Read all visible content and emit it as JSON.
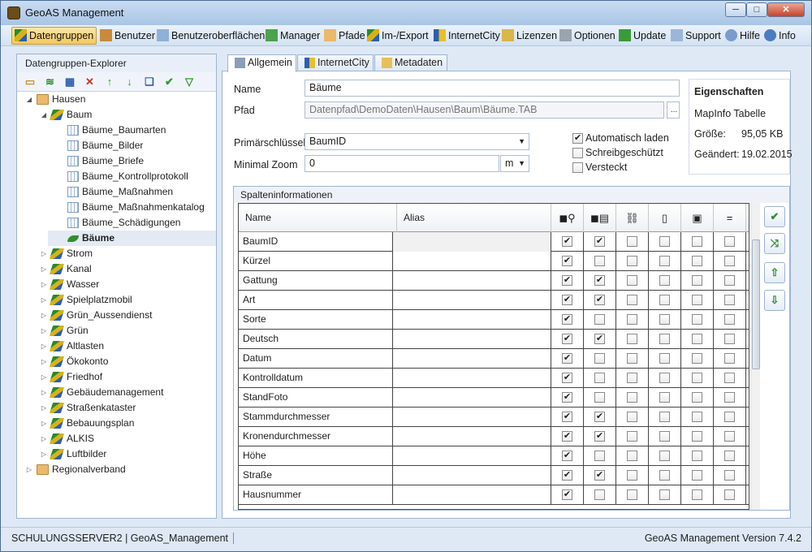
{
  "window": {
    "title": "GeoAS Management",
    "min_label": "─",
    "max_label": "□",
    "close_label": "✕"
  },
  "toolbar": [
    {
      "label": "Datengruppen",
      "icon": "layers-icon",
      "active": true
    },
    {
      "label": "Benutzer",
      "icon": "user-icon"
    },
    {
      "label": "Benutzeroberflächen",
      "icon": "window-icon"
    },
    {
      "label": "Manager",
      "icon": "puzzle-icon"
    },
    {
      "label": "Pfade",
      "icon": "folder-icon"
    },
    {
      "label": "Im-/Export",
      "icon": "layers-icon"
    },
    {
      "label": "InternetCity",
      "icon": "internetcity-icon"
    },
    {
      "label": "Lizenzen",
      "icon": "key-icon"
    },
    {
      "label": "Optionen",
      "icon": "gear-icon"
    },
    {
      "label": "Update",
      "icon": "refresh-icon"
    },
    {
      "label": "Support",
      "icon": "mail-icon"
    },
    {
      "label": "Hilfe",
      "icon": "help-icon"
    },
    {
      "label": "Info",
      "icon": "info-icon"
    }
  ],
  "explorer": {
    "title": "Datengruppen-Explorer",
    "tools": [
      "add-folder-icon",
      "add-layer-icon",
      "add-table-icon",
      "delete-icon",
      "move-up-icon",
      "move-down-icon",
      "book-icon",
      "check-icon",
      "filter-icon"
    ],
    "tree": [
      {
        "label": "Hausen",
        "level": 0,
        "icon": "folder",
        "expander": "▲"
      },
      {
        "label": "Baum",
        "level": 1,
        "icon": "layers",
        "expander": "▲"
      },
      {
        "label": "Bäume_Baumarten",
        "level": 2,
        "icon": "table"
      },
      {
        "label": "Bäume_Bilder",
        "level": 2,
        "icon": "table"
      },
      {
        "label": "Bäume_Briefe",
        "level": 2,
        "icon": "table"
      },
      {
        "label": "Bäume_Kontrollprotokoll",
        "level": 2,
        "icon": "table"
      },
      {
        "label": "Bäume_Maßnahmen",
        "level": 2,
        "icon": "table"
      },
      {
        "label": "Bäume_Maßnahmenkatalog",
        "level": 2,
        "icon": "table"
      },
      {
        "label": "Bäume_Schädigungen",
        "level": 2,
        "icon": "table"
      },
      {
        "label": "Bäume",
        "level": 2,
        "icon": "leaf",
        "selected": true
      },
      {
        "label": "Strom",
        "level": 1,
        "icon": "layers",
        "expander": "▷"
      },
      {
        "label": "Kanal",
        "level": 1,
        "icon": "layers",
        "expander": "▷"
      },
      {
        "label": "Wasser",
        "level": 1,
        "icon": "layers",
        "expander": "▷"
      },
      {
        "label": "Spielplatzmobil",
        "level": 1,
        "icon": "layers",
        "expander": "▷"
      },
      {
        "label": "Grün_Aussendienst",
        "level": 1,
        "icon": "layers",
        "expander": "▷"
      },
      {
        "label": "Grün",
        "level": 1,
        "icon": "layers",
        "expander": "▷"
      },
      {
        "label": "Altlasten",
        "level": 1,
        "icon": "layers",
        "expander": "▷"
      },
      {
        "label": "Ökokonto",
        "level": 1,
        "icon": "layers",
        "expander": "▷"
      },
      {
        "label": "Friedhof",
        "level": 1,
        "icon": "layers",
        "expander": "▷"
      },
      {
        "label": "Gebäudemanagement",
        "level": 1,
        "icon": "layers",
        "expander": "▷"
      },
      {
        "label": "Straßenkataster",
        "level": 1,
        "icon": "layers",
        "expander": "▷"
      },
      {
        "label": "Bebauungsplan",
        "level": 1,
        "icon": "layers",
        "expander": "▷"
      },
      {
        "label": "ALKIS",
        "level": 1,
        "icon": "layers",
        "expander": "▷"
      },
      {
        "label": "Luftbilder",
        "level": 1,
        "icon": "layers",
        "expander": "▷"
      },
      {
        "label": "Regionalverband",
        "level": 0,
        "icon": "folder",
        "expander": "▷"
      }
    ]
  },
  "tabs": [
    {
      "label": "Allgemein",
      "active": true
    },
    {
      "label": "InternetCity"
    },
    {
      "label": "Metadaten"
    }
  ],
  "form": {
    "name_label": "Name",
    "name_value": "Bäume",
    "path_label": "Pfad",
    "path_value": "Datenpfad\\DemoDaten\\Hausen\\Baum\\Bäume.TAB",
    "browse_label": "...",
    "pk_label": "Primärschlüssel",
    "pk_value": "BaumID",
    "zoom_label": "Minimal Zoom",
    "zoom_value": "0",
    "zoom_unit": "m",
    "auto_load_label": "Automatisch laden",
    "auto_load": true,
    "readonly_label": "Schreibgeschützt",
    "readonly": false,
    "hidden_label": "Versteckt",
    "hidden": false
  },
  "properties": {
    "title": "Eigenschaften",
    "type": "MapInfo Tabelle",
    "size_label": "Größe:",
    "size_value": "95,05 KB",
    "changed_label": "Geändert:",
    "changed_value": "19.02.2015"
  },
  "columns": {
    "title": "Spalteninformationen",
    "headers": {
      "name": "Name",
      "alias": "Alias",
      "icons": [
        "select-search-icon",
        "select-list-icon",
        "link-icon",
        "document-icon",
        "image-icon",
        "equals-icon"
      ]
    },
    "rows": [
      {
        "name": "BaumID",
        "alias": "",
        "flags": [
          1,
          1,
          0,
          0,
          0,
          0
        ]
      },
      {
        "name": "Kürzel",
        "alias": "",
        "flags": [
          1,
          0,
          0,
          0,
          0,
          0
        ]
      },
      {
        "name": "Gattung",
        "alias": "",
        "flags": [
          1,
          1,
          0,
          0,
          0,
          0
        ]
      },
      {
        "name": "Art",
        "alias": "",
        "flags": [
          1,
          1,
          0,
          0,
          0,
          0
        ]
      },
      {
        "name": "Sorte",
        "alias": "",
        "flags": [
          1,
          0,
          0,
          0,
          0,
          0
        ]
      },
      {
        "name": "Deutsch",
        "alias": "",
        "flags": [
          1,
          1,
          0,
          0,
          0,
          0
        ]
      },
      {
        "name": "Datum",
        "alias": "",
        "flags": [
          1,
          0,
          0,
          0,
          0,
          0
        ]
      },
      {
        "name": "Kontrolldatum",
        "alias": "",
        "flags": [
          1,
          0,
          0,
          0,
          0,
          0
        ]
      },
      {
        "name": "StandFoto",
        "alias": "",
        "flags": [
          1,
          0,
          0,
          0,
          0,
          0
        ]
      },
      {
        "name": "Stammdurchmesser",
        "alias": "",
        "flags": [
          1,
          1,
          0,
          0,
          0,
          0
        ]
      },
      {
        "name": "Kronendurchmesser",
        "alias": "",
        "flags": [
          1,
          1,
          0,
          0,
          0,
          0
        ]
      },
      {
        "name": "Höhe",
        "alias": "",
        "flags": [
          1,
          0,
          0,
          0,
          0,
          0
        ]
      },
      {
        "name": "Straße",
        "alias": "",
        "flags": [
          1,
          1,
          0,
          0,
          0,
          0
        ]
      },
      {
        "name": "Hausnummer",
        "alias": "",
        "flags": [
          1,
          0,
          0,
          0,
          0,
          0
        ]
      }
    ],
    "side_buttons": [
      "check-icon",
      "shuffle-icon",
      "arrow-up-icon",
      "arrow-down-icon"
    ]
  },
  "status": {
    "left": "SCHULUNGSSERVER2 | GeoAS_Management",
    "right": "GeoAS Management Version 7.4.2"
  },
  "colors": {
    "accent": "#f5c85c",
    "panel_border": "#9eb4cf",
    "frame": "#dfe9f5"
  }
}
